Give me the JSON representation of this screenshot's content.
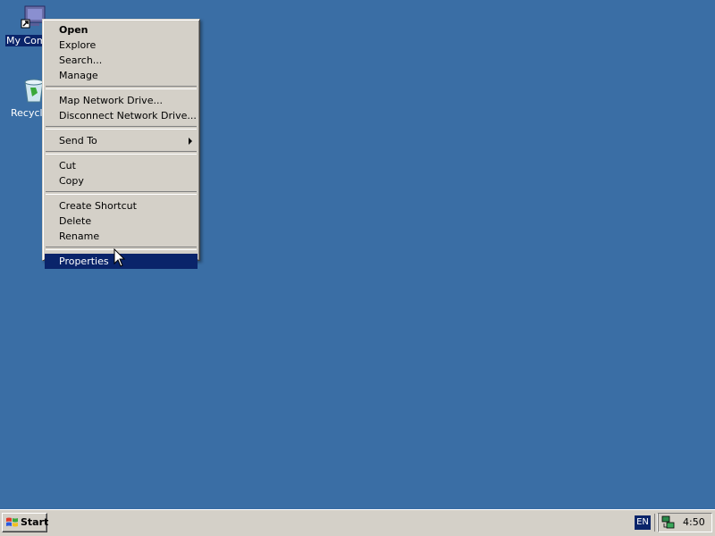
{
  "desktop": {
    "background_color": "#3a6ea5",
    "icons": [
      {
        "label": "My Com",
        "icon": "my-computer-icon",
        "selected": true
      },
      {
        "label": "Recycle",
        "icon": "recycle-bin-icon",
        "selected": false
      }
    ]
  },
  "context_menu": {
    "groups": [
      [
        {
          "label": "Open",
          "default": true
        },
        {
          "label": "Explore"
        },
        {
          "label": "Search..."
        },
        {
          "label": "Manage"
        }
      ],
      [
        {
          "label": "Map Network Drive..."
        },
        {
          "label": "Disconnect Network Drive..."
        }
      ],
      [
        {
          "label": "Send To",
          "submenu": true
        }
      ],
      [
        {
          "label": "Cut"
        },
        {
          "label": "Copy"
        }
      ],
      [
        {
          "label": "Create Shortcut"
        },
        {
          "label": "Delete"
        },
        {
          "label": "Rename"
        }
      ],
      [
        {
          "label": "Properties",
          "highlighted": true
        }
      ]
    ],
    "highlight_color": "#0a246a"
  },
  "taskbar": {
    "start_label": "Start",
    "language": "EN",
    "clock": "4:50",
    "tray_icons": [
      "network-icon"
    ]
  }
}
